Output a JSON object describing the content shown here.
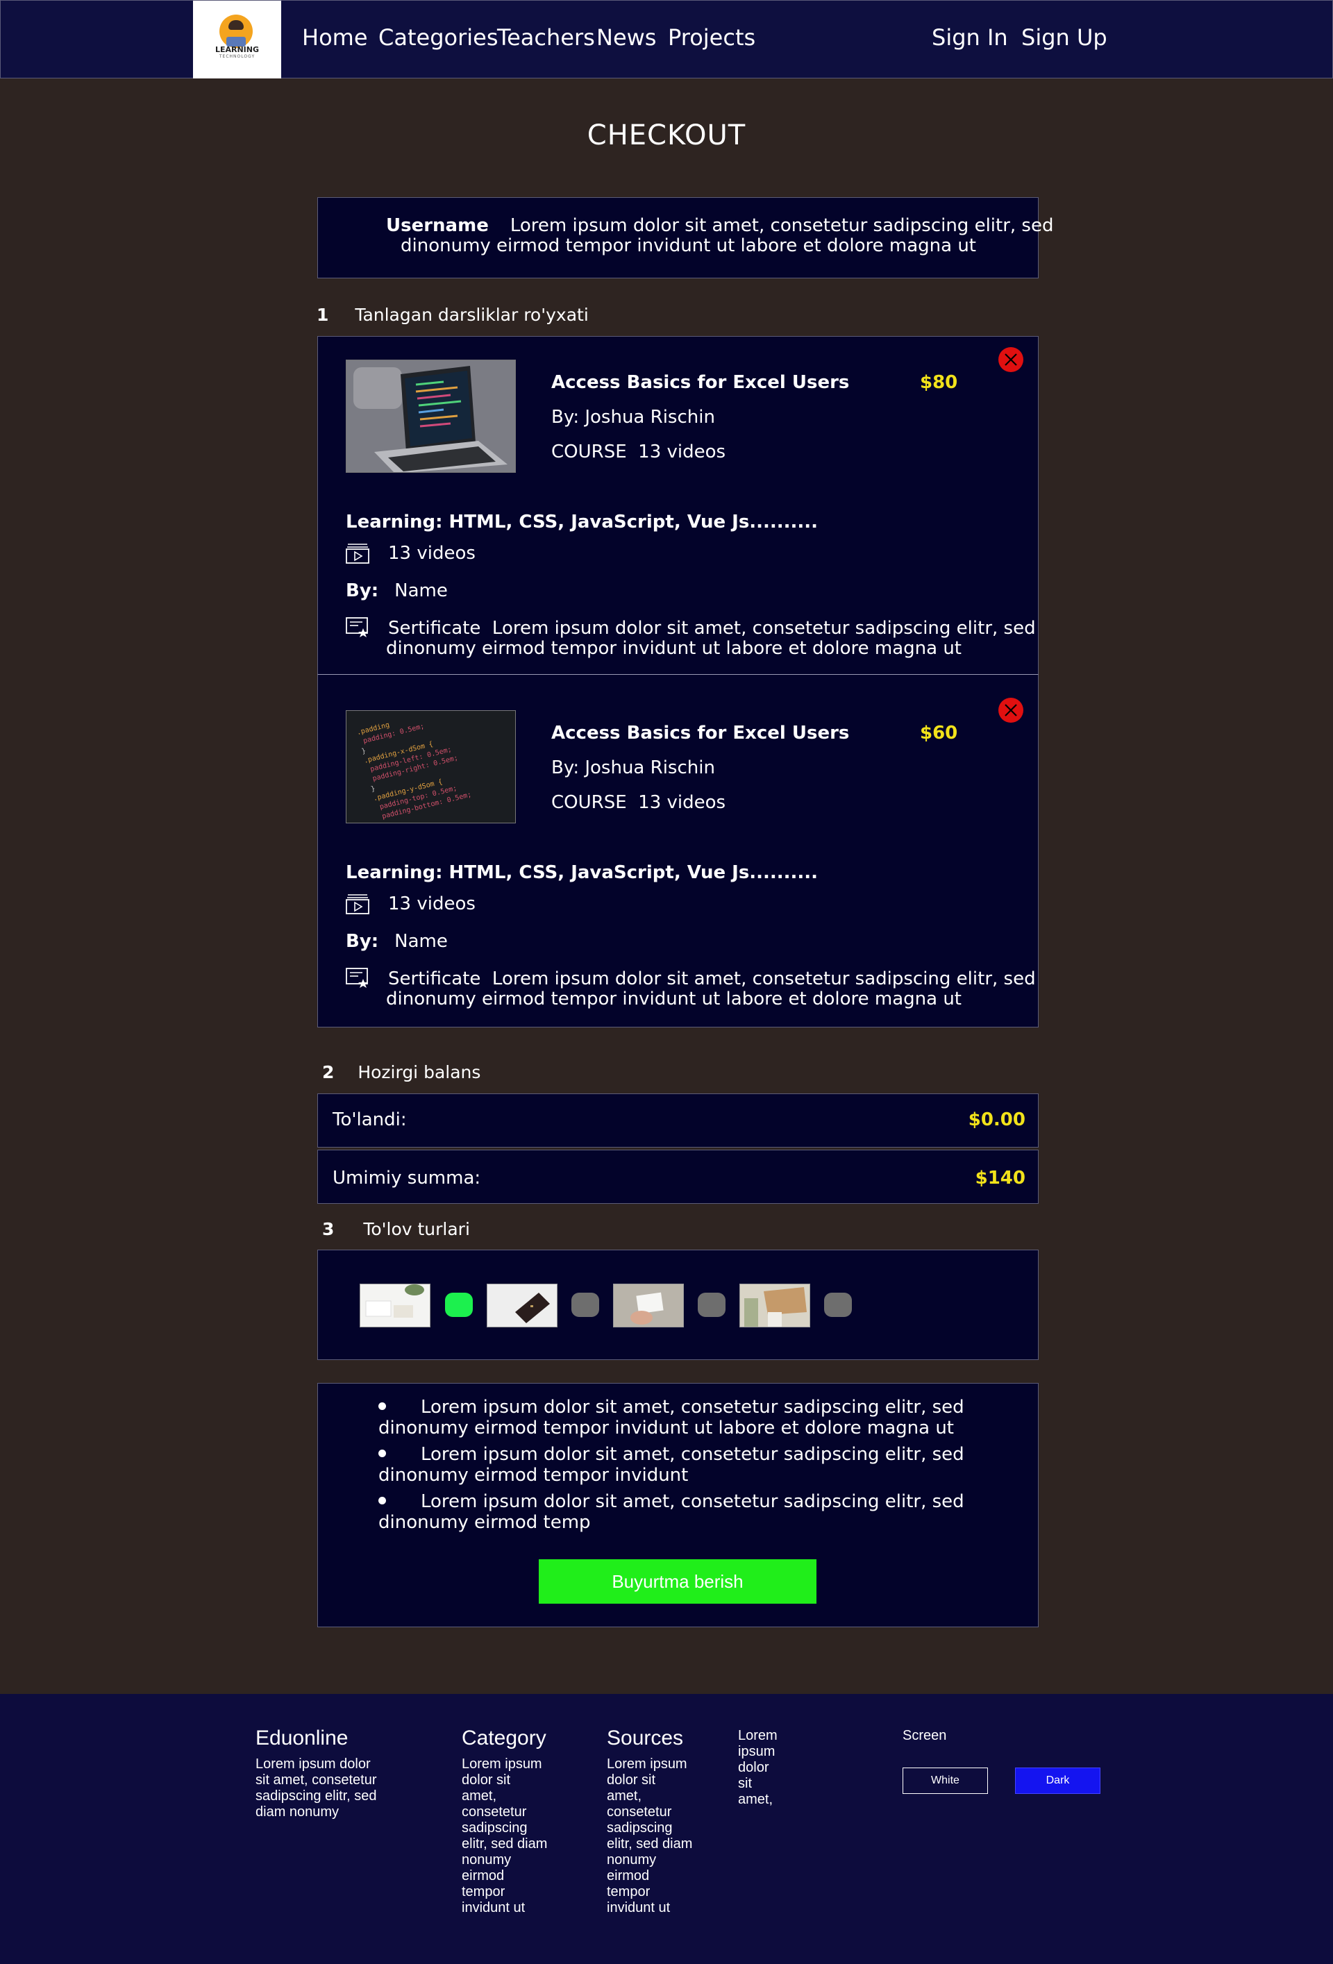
{
  "header": {
    "logo_text": "LEARNING",
    "logo_sub": "TECHNOLOGY",
    "nav": [
      "Home",
      "Categories",
      "Teachers",
      "News",
      "Projects"
    ],
    "sign_in": "Sign In",
    "sign_up": "Sign Up"
  },
  "page_title": "CHECKOUT",
  "user": {
    "label": "Username",
    "text_line1": "Lorem ipsum dolor sit amet, consetetur sadipscing elitr, sed",
    "text_line2": "dinonumy eirmod tempor invidunt ut labore et dolore magna ut"
  },
  "sections": {
    "s1_num": "1",
    "s1_label": "Tanlagan darsliklar ro'yxati",
    "s2_num": "2",
    "s2_label": "Hozirgi balans",
    "s3_num": "3",
    "s3_label": "To'lov turlari"
  },
  "courses": [
    {
      "title": "Access Basics for Excel Users",
      "price": "$80",
      "author": "By: Joshua Rischin",
      "meta": "COURSE  13 videos",
      "learning": "Learning: HTML, CSS, JavaScript, Vue Js..........",
      "videos": "13 videos",
      "by_label": "By:",
      "by_name": "Name",
      "cert_line1": "Sertificate  Lorem ipsum dolor sit amet, consetetur sadipscing elitr, sed",
      "cert_line2": "dinonumy eirmod tempor invidunt ut labore et dolore magna ut"
    },
    {
      "title": "Access Basics for Excel Users",
      "price": "$60",
      "author": "By: Joshua Rischin",
      "meta": "COURSE  13 videos",
      "learning": "Learning: HTML, CSS, JavaScript, Vue Js..........",
      "videos": "13 videos",
      "by_label": "By:",
      "by_name": "Name",
      "cert_line1": "Sertificate  Lorem ipsum dolor sit amet, consetetur sadipscing elitr, sed",
      "cert_line2": "dinonumy eirmod tempor invidunt ut labore et dolore magna ut"
    }
  ],
  "balance": {
    "paid_label": "To'landi:",
    "paid_value": "$0.00",
    "total_label": "Umimiy summa:",
    "total_value": "$140"
  },
  "payment": {
    "selected_index": 0,
    "active_color": "#1cf04e",
    "inactive_color": "#6e6e6e"
  },
  "terms": [
    {
      "line1": "Lorem ipsum dolor sit amet, consetetur sadipscing elitr, sed",
      "line2": "dinonumy eirmod tempor invidunt ut labore et dolore magna ut"
    },
    {
      "line1": "Lorem ipsum dolor sit amet, consetetur sadipscing elitr, sed",
      "line2": "dinonumy eirmod tempor invidunt"
    },
    {
      "line1": "Lorem ipsum dolor sit amet, consetetur sadipscing elitr, sed",
      "line2": "dinonumy eirmod temp"
    }
  ],
  "order_button": "Buyurtma berish",
  "footer": {
    "col1_title": "Eduonline",
    "col1_lines": [
      "Lorem ipsum dolor",
      "sit amet, consetetur",
      "sadipscing elitr, sed",
      "diam nonumy"
    ],
    "col2_title": "Category",
    "col2_lines": [
      "Lorem ipsum",
      "dolor sit",
      "amet,",
      "consetetur",
      "sadipscing",
      "elitr, sed diam",
      "nonumy",
      "eirmod",
      "tempor",
      "invidunt ut"
    ],
    "col3_title": "Sources",
    "col3_lines": [
      "Lorem ipsum",
      "dolor sit",
      "amet,",
      "consetetur",
      "sadipscing",
      "elitr, sed diam",
      "nonumy",
      "eirmod",
      "tempor",
      "invidunt ut"
    ],
    "col4_lines": [
      "Lorem",
      "ipsum",
      "dolor",
      "sit",
      "amet,"
    ],
    "screen_label": "Screen",
    "white_label": "White",
    "dark_label": "Dark"
  },
  "colors": {
    "accent_price": "#f2e21a",
    "remove": "#e01010",
    "order_button": "#20ee1a",
    "dark_button": "#1414f0"
  }
}
